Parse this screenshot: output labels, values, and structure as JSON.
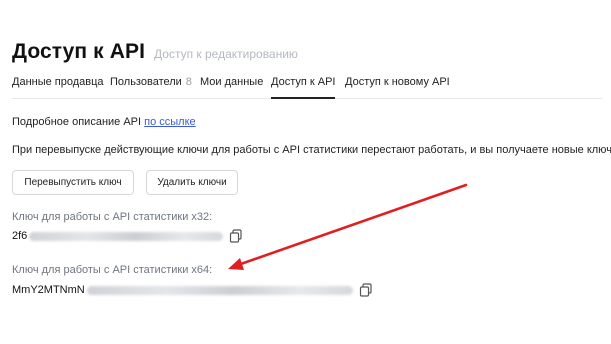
{
  "header": {
    "title": "Доступ к API",
    "subtitle": "Доступ к редактированию"
  },
  "tabs": [
    {
      "label": "Данные продавца",
      "count": ""
    },
    {
      "label": "Пользователи",
      "count": "8"
    },
    {
      "label": "Мои данные",
      "count": ""
    },
    {
      "label": "Доступ к API",
      "count": ""
    },
    {
      "label": "Доступ к новому API",
      "count": ""
    }
  ],
  "active_tab": "Доступ к API",
  "description": {
    "text": "Подробное описание API",
    "link_text": "по ссылке"
  },
  "notice": "При перевыпуске действующие ключи для работы с API статистики перестают работать, и вы получаете новые ключи.",
  "buttons": {
    "reissue": "Перевыпустить ключ",
    "delete": "Удалить ключи"
  },
  "keys": [
    {
      "label": "Ключ для работы с API статистики x32:",
      "value_prefix": "2f6",
      "masked": true
    },
    {
      "label": "Ключ для работы с API статистики x64:",
      "value_prefix": "MmY2MTNmN",
      "masked": true
    }
  ],
  "icons": {
    "copy": "copy-icon"
  },
  "annotation": {
    "color": "#e02020"
  }
}
